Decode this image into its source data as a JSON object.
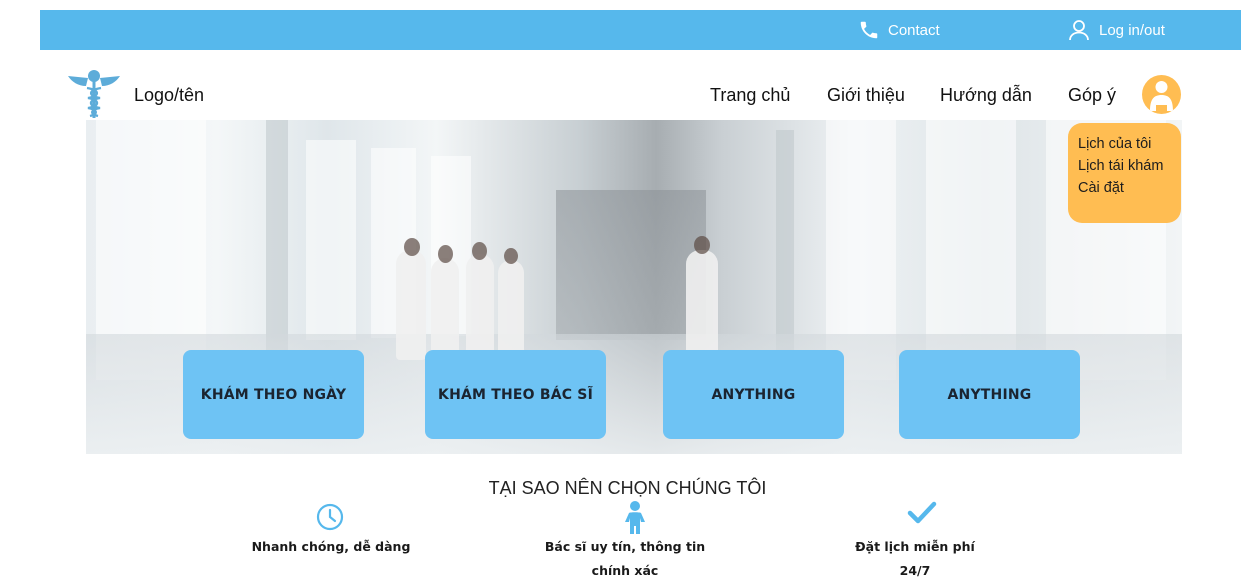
{
  "topbar": {
    "contact_label": "Contact",
    "login_label": "Log in/out",
    "color": "#56b8ec"
  },
  "brand": {
    "logo_icon": "caduceus-icon",
    "logo_text": "Logo/tên",
    "color": "#5dacd9"
  },
  "nav": {
    "items": [
      {
        "label": "Trang chủ"
      },
      {
        "label": "Giới thiệu"
      },
      {
        "label": "Hướng dẫn"
      },
      {
        "label": "Góp ý"
      }
    ],
    "avatar_icon": "user-avatar-icon",
    "avatar_color": "#ffbd52"
  },
  "user_menu": {
    "items": [
      {
        "label": "Lịch của tôi"
      },
      {
        "label": "Lịch tái khám"
      },
      {
        "label": "Cài đặt"
      }
    ],
    "color": "#ffbd52"
  },
  "hero": {
    "image": "hospital-corridor-background",
    "buttons": [
      {
        "label": "KHÁM THEO NGÀY"
      },
      {
        "label": "KHÁM THEO BÁC SĨ"
      },
      {
        "label": "ANYTHING"
      },
      {
        "label": "ANYTHING"
      }
    ],
    "button_color": "#6ec3f4"
  },
  "why": {
    "title": "TẠI SAO NÊN CHỌN CHÚNG TÔI",
    "features": [
      {
        "icon": "clock-icon",
        "line1": "Nhanh chóng, dễ dàng",
        "line2": ""
      },
      {
        "icon": "person-icon",
        "line1": "Bác sĩ uy tín, thông tin",
        "line2": "chính xác"
      },
      {
        "icon": "checkmark-icon",
        "line1": "Đặt lịch miễn phí",
        "line2": "24/7"
      }
    ],
    "icon_color": "#56b8ec"
  }
}
